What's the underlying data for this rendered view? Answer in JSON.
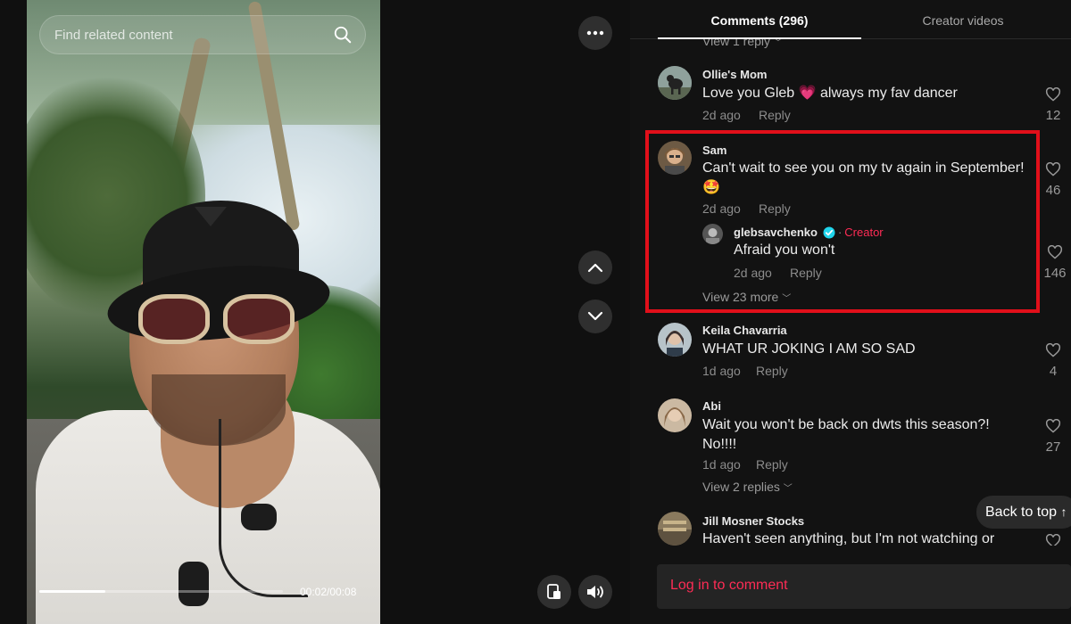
{
  "search": {
    "placeholder": "Find related content"
  },
  "player": {
    "time": "00:02/00:08",
    "progress_fraction": 0.27
  },
  "tabs": [
    {
      "label": "Comments (296)",
      "active": true
    },
    {
      "label": "Creator videos",
      "active": false
    }
  ],
  "comments": {
    "top_view_replies": "View 1 reply",
    "items": [
      {
        "user": "Ollie's Mom",
        "text_before": "Love you Gleb",
        "emoji": "💗",
        "text_after": "always my fav dancer",
        "date": "2d ago",
        "reply": "Reply",
        "likes": "12"
      },
      {
        "user": "Sam",
        "text": "Can't wait to see you on my tv again in September!",
        "emoji": "🤩",
        "date": "2d ago",
        "reply": "Reply",
        "likes": "46",
        "sub": {
          "user": "glebsavchenko",
          "badge": "Creator",
          "text": "Afraid you won't",
          "date": "2d ago",
          "reply": "Reply",
          "likes": "146"
        },
        "view_more": "View 23 more"
      },
      {
        "user": "Keila Chavarria",
        "text": "WHAT UR JOKING I AM SO SAD",
        "date": "1d ago",
        "reply": "Reply",
        "likes": "4"
      },
      {
        "user": "Abi",
        "text_line1": "Wait you won't be back on dwts this season?!",
        "text_line2": "No!!!!",
        "date": "1d ago",
        "reply": "Reply",
        "likes": "27",
        "view_replies": "View 2 replies"
      },
      {
        "user": "Jill Mosner Stocks",
        "text": "Haven't seen anything, but I'm not watching or"
      }
    ]
  },
  "back_to_top": "Back to top",
  "login": {
    "label": "Log in to comment"
  },
  "colors": {
    "accent": "#fe2c55",
    "highlight": "#e10f1a",
    "verified": "#20d5ec"
  }
}
